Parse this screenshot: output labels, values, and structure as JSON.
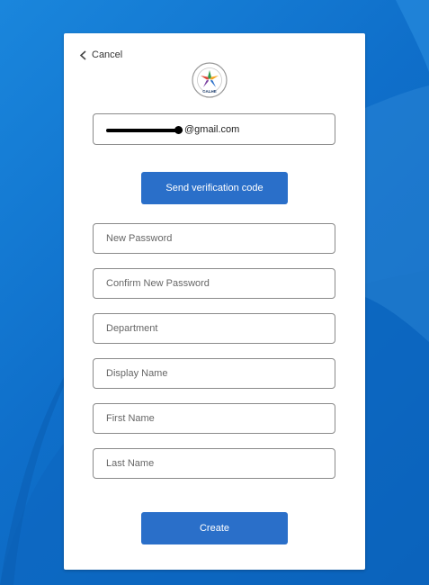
{
  "cancel": {
    "label": "Cancel"
  },
  "logo": {
    "label": "CALHE"
  },
  "email": {
    "suffix": "@gmail.com"
  },
  "send_code": {
    "label": "Send verification code"
  },
  "fields": {
    "new_password": {
      "placeholder": "New Password"
    },
    "confirm_password": {
      "placeholder": "Confirm New Password"
    },
    "department": {
      "placeholder": "Department"
    },
    "display_name": {
      "placeholder": "Display Name"
    },
    "first_name": {
      "placeholder": "First Name"
    },
    "last_name": {
      "placeholder": "Last Name"
    }
  },
  "create": {
    "label": "Create"
  },
  "colors": {
    "background": "#0f6fca",
    "button": "#2a6fc9",
    "card": "#ffffff"
  }
}
